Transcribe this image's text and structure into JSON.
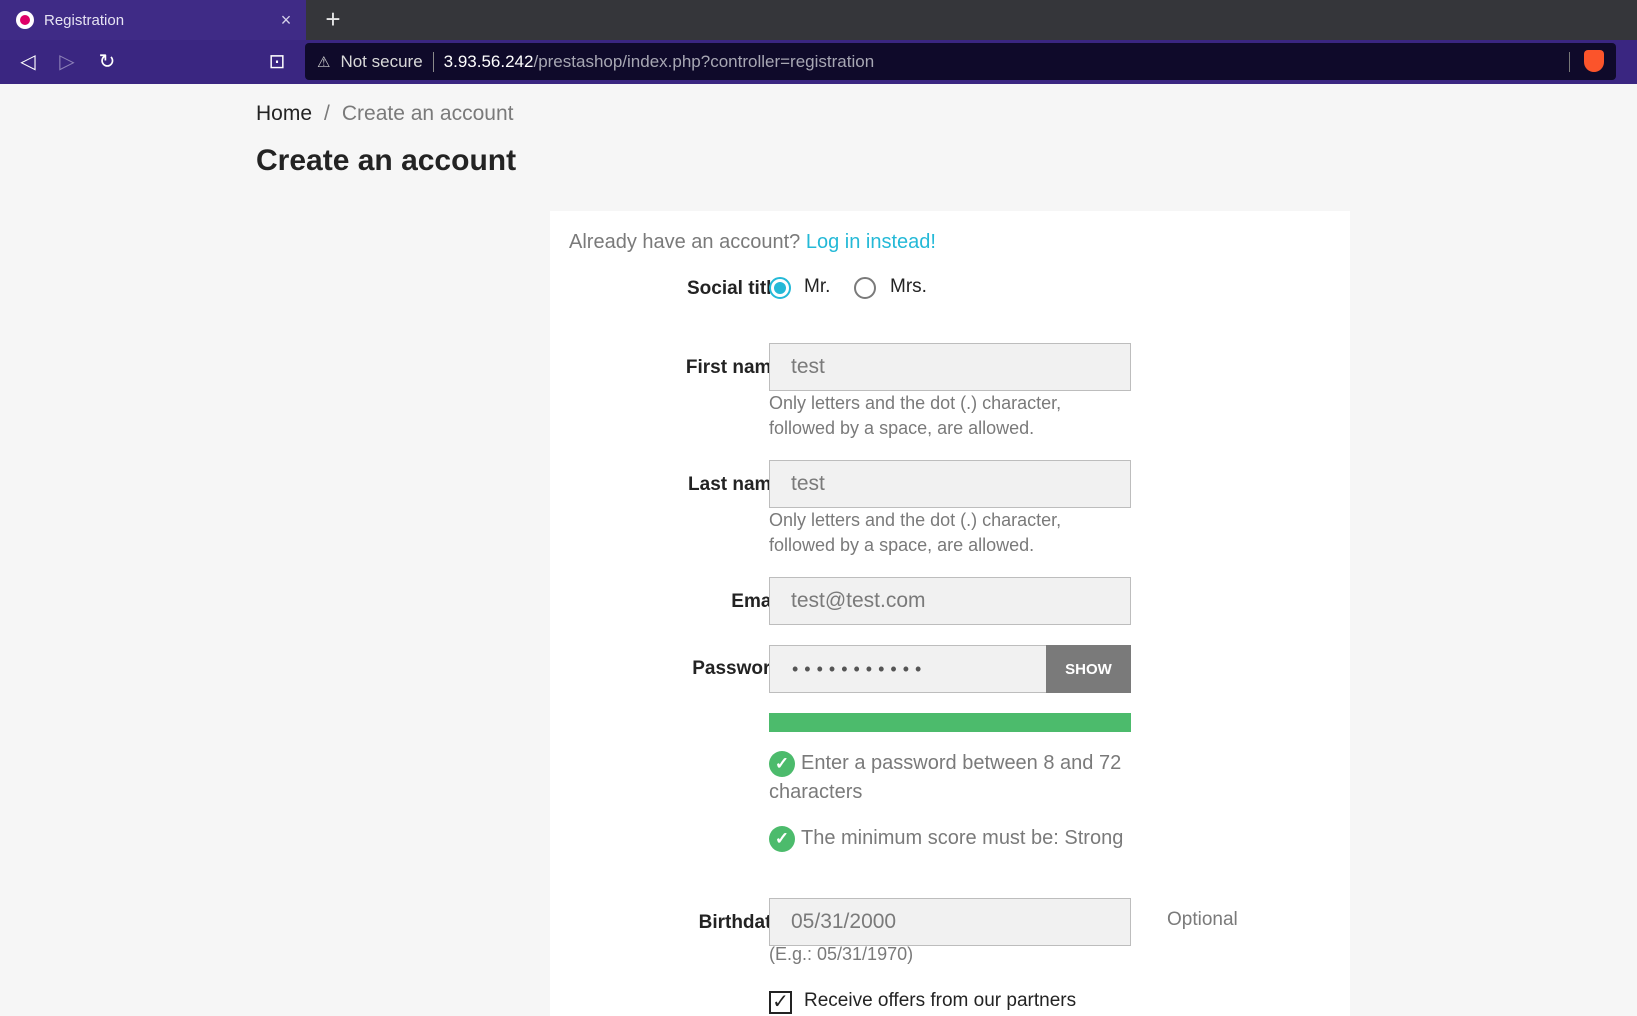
{
  "browser": {
    "tab_title": "Registration",
    "tab_close": "×",
    "new_tab": "+",
    "back": "◁",
    "forward": "▷",
    "reload": "↻",
    "bookmark": "⊡",
    "address_warning": "⚠",
    "address_status": "Not secure",
    "address_host": "3.93.56.242",
    "address_path": "/prestashop/index.php?controller=registration"
  },
  "breadcrumb": {
    "home": "Home",
    "separator": "/",
    "current": "Create an account"
  },
  "page_title": "Create an account",
  "form": {
    "already_text": "Already have an account?",
    "login_link": "Log in instead!",
    "social_title_label": "Social title",
    "social_title_options": [
      "Mr.",
      "Mrs."
    ],
    "social_title_selected": "Mr.",
    "first_name_label": "First name",
    "first_name_value": "test",
    "first_name_help_1": "Only letters and the dot (.) character,",
    "first_name_help_2": "followed by a space, are allowed.",
    "last_name_label": "Last name",
    "last_name_value": "test",
    "last_name_help_1": "Only letters and the dot (.) character,",
    "last_name_help_2": "followed by a space, are allowed.",
    "email_label": "Email",
    "email_value": "test@test.com",
    "password_label": "Password",
    "password_masked": "•••••••••••",
    "show_button": "SHOW",
    "password_strength": 1.0,
    "rule_length_1": "Enter a password between 8 and 72",
    "rule_length_2": "characters",
    "rule_score": "The minimum score must be: Strong",
    "check_mark": "✓",
    "birthdate_label": "Birthdate",
    "birthdate_value": "05/31/2000",
    "birthdate_optional": "Optional",
    "birthdate_example": "(E.g.: 05/31/1970)",
    "partners_checked": true,
    "partners_label": "Receive offers from our partners"
  },
  "colors": {
    "accent": "#24b9d7",
    "success": "#4cbb6c",
    "tab_purple": "#3f2b86"
  }
}
